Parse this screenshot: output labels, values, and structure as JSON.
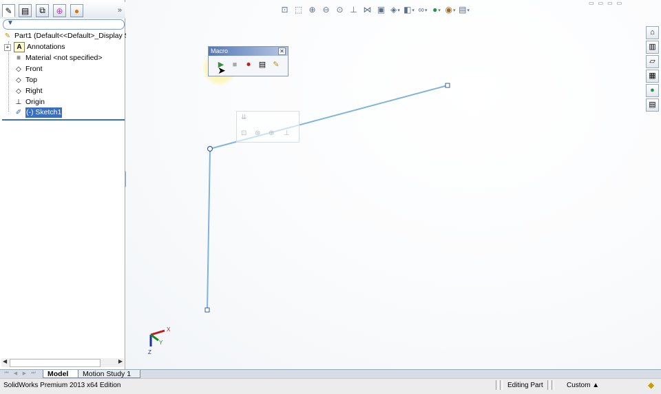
{
  "tree": {
    "root_label": "Part1  (Default<<Default>_Display S",
    "items": [
      {
        "label": "Annotations",
        "icon": "A"
      },
      {
        "label": "Material <not specified>",
        "icon": "≡"
      },
      {
        "label": "Front",
        "icon": "◇"
      },
      {
        "label": "Top",
        "icon": "◇"
      },
      {
        "label": "Right",
        "icon": "◇"
      },
      {
        "label": "Origin",
        "icon": "⊥"
      }
    ],
    "selected_label": "(-) Sketch1",
    "expander": "+"
  },
  "pane_tabs": {
    "more": "»"
  },
  "filter": {
    "icon": "▼"
  },
  "macro": {
    "title": "Macro",
    "close": "✕"
  },
  "bottom_tabs": [
    {
      "label": "Model",
      "active": true
    },
    {
      "label": "Motion Study 1",
      "active": false
    }
  ],
  "status": {
    "product": "SolidWorks Premium 2013 x64 Edition",
    "mode": "Editing Part",
    "units": "Custom  ▲"
  },
  "triad": {
    "x": "X",
    "y": "Y",
    "z": "Z"
  },
  "sketch": {
    "line_color": "#7fb2e0",
    "accent": "#3a6fbf"
  }
}
